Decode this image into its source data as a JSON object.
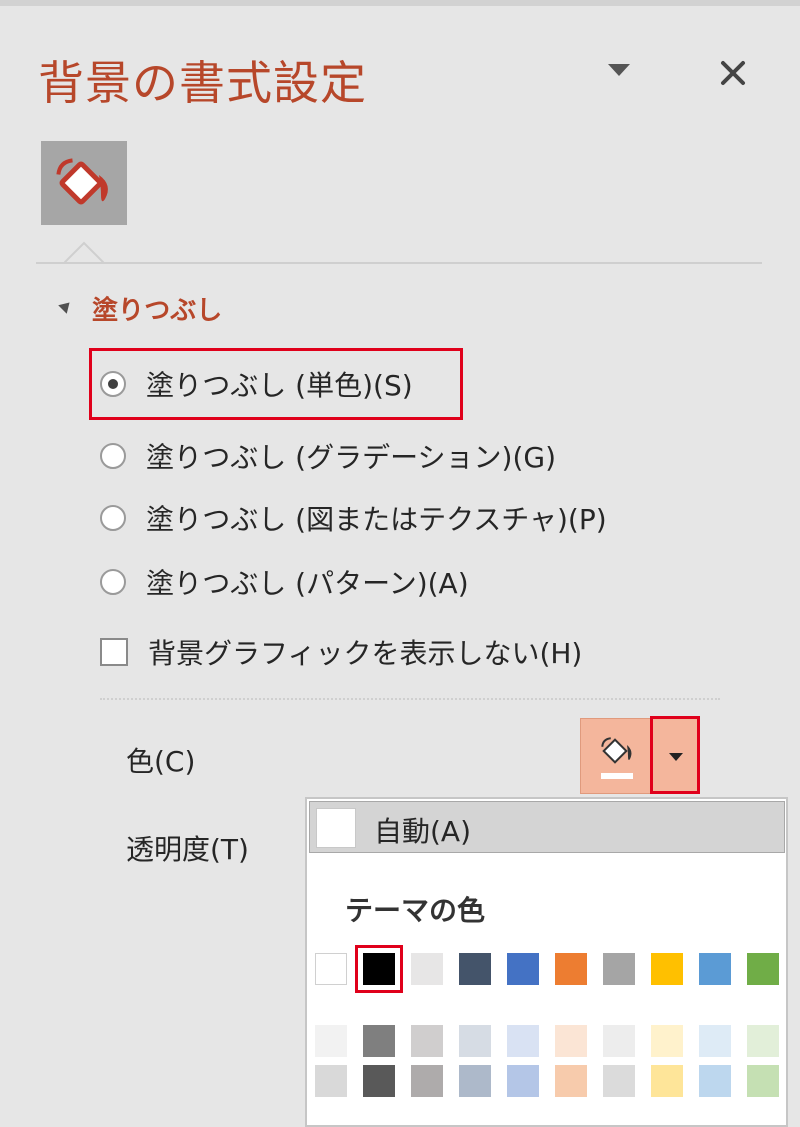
{
  "pane": {
    "title": "背景の書式設定"
  },
  "section": {
    "label": "塗りつぶし"
  },
  "fill_options": [
    {
      "label": "塗りつぶし (単色)(S)",
      "checked": true
    },
    {
      "label": "塗りつぶし (グラデーション)(G)",
      "checked": false
    },
    {
      "label": "塗りつぶし (図またはテクスチャ)(P)",
      "checked": false
    },
    {
      "label": "塗りつぶし (パターン)(A)",
      "checked": false
    }
  ],
  "hide_background_graphics": {
    "label": "背景グラフィックを表示しない(H)",
    "checked": false
  },
  "color": {
    "label": "色(C)",
    "current": "#ffffff"
  },
  "transparency": {
    "label": "透明度(T)"
  },
  "color_popup": {
    "automatic_label": "自動(A)",
    "theme_colors_header": "テーマの色",
    "theme_colors": [
      "#ffffff",
      "#000000",
      "#e7e6e6",
      "#44546a",
      "#4472c4",
      "#ed7d31",
      "#a5a5a5",
      "#ffc000",
      "#5b9bd5",
      "#70ad47"
    ],
    "selected_index": 1,
    "shades": [
      [
        "#f2f2f2",
        "#d9d9d9"
      ],
      [
        "#7f7f7f",
        "#595959"
      ],
      [
        "#d0cece",
        "#aeabab"
      ],
      [
        "#d6dce4",
        "#adb9ca"
      ],
      [
        "#d9e2f3",
        "#b4c6e7"
      ],
      [
        "#fbe5d5",
        "#f7cbac"
      ],
      [
        "#ededed",
        "#dbdbdb"
      ],
      [
        "#fff2cc",
        "#fee599"
      ],
      [
        "#deebf6",
        "#bdd7ee"
      ],
      [
        "#e2efd9",
        "#c5e0b3"
      ]
    ]
  },
  "colors": {
    "accent": "#b7472a",
    "highlight": "#e0001b",
    "button_fill": "#f4b69c"
  },
  "icons": {
    "pane_menu": "chevron-down-icon",
    "close": "close-icon",
    "fill_tab": "paint-bucket-icon"
  }
}
